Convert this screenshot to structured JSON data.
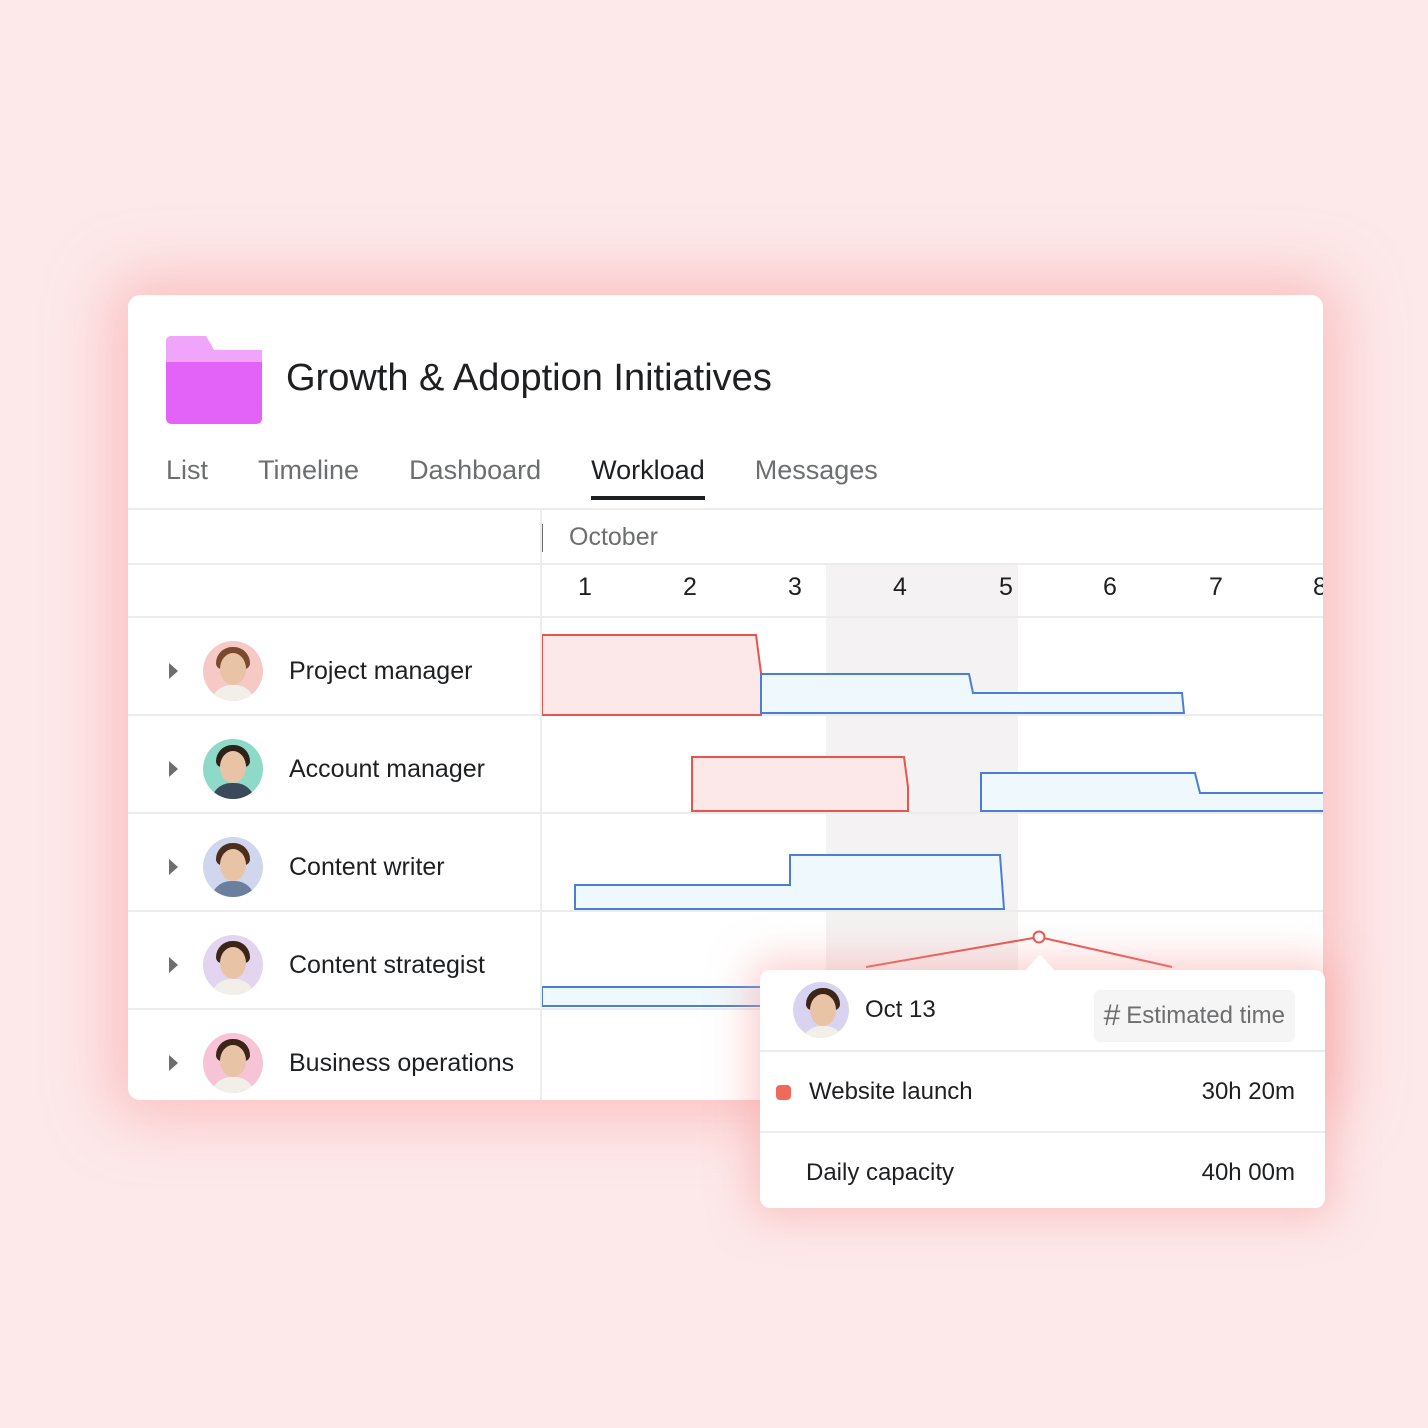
{
  "project": {
    "title": "Growth & Adoption Initiatives",
    "icon": "folder-icon",
    "icon_color": "#e362f7"
  },
  "tabs": [
    {
      "label": "List",
      "active": false
    },
    {
      "label": "Timeline",
      "active": false
    },
    {
      "label": "Dashboard",
      "active": false
    },
    {
      "label": "Workload",
      "active": true
    },
    {
      "label": "Messages",
      "active": false
    }
  ],
  "timeline": {
    "month": "October",
    "days": [
      "1",
      "2",
      "3",
      "4",
      "5",
      "6",
      "7",
      "8"
    ]
  },
  "rows": [
    {
      "label": "Project manager",
      "avatar_bg": "#f7c9c4"
    },
    {
      "label": "Account manager",
      "avatar_bg": "#8fd9c9"
    },
    {
      "label": "Content writer",
      "avatar_bg": "#cfd6ee"
    },
    {
      "label": "Content strategist",
      "avatar_bg": "#e3d5ef"
    },
    {
      "label": "Business operations",
      "avatar_bg": "#f6c4d6"
    }
  ],
  "colors": {
    "over_capacity": "#e8554e",
    "under_capacity": "#4a7fd6",
    "background": "#fde9ea"
  },
  "tooltip": {
    "date": "Oct 13",
    "field_label": "Estimated time",
    "field_icon": "hash-icon",
    "task": {
      "label": "Website launch",
      "value": "30h 20m",
      "color": "#f06a5c"
    },
    "capacity": {
      "label": "Daily capacity",
      "value": "40h 00m"
    }
  }
}
